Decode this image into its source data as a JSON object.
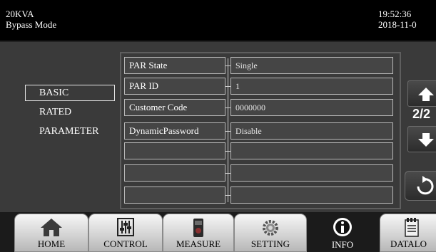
{
  "header": {
    "model": "20KVA",
    "mode": "Bypass Mode",
    "time": "19:52:36",
    "date": "2018-11-0"
  },
  "sidebar": {
    "items": [
      {
        "label": "BASIC",
        "selected": true
      },
      {
        "label": "RATED",
        "selected": false
      },
      {
        "label": "PARAMETER",
        "selected": false
      }
    ]
  },
  "table": {
    "rows": [
      {
        "label": "PAR State",
        "value": "Single"
      },
      {
        "label": "PAR ID",
        "value": "1"
      },
      {
        "label": "Customer Code",
        "value": "0000000"
      },
      {
        "label": "DynamicPassword",
        "value": "Disable"
      },
      {
        "label": "",
        "value": ""
      },
      {
        "label": "",
        "value": ""
      },
      {
        "label": "",
        "value": ""
      }
    ]
  },
  "pager": {
    "indicator": "2/2",
    "up_icon": "arrow-up-icon",
    "down_icon": "arrow-down-icon",
    "back_icon": "return-icon"
  },
  "toolbar": {
    "tabs": [
      {
        "label": "HOME",
        "icon": "home-icon",
        "active": false
      },
      {
        "label": "CONTROL",
        "icon": "sliders-icon",
        "active": false
      },
      {
        "label": "MEASURE",
        "icon": "meter-icon",
        "active": false
      },
      {
        "label": "SETTING",
        "icon": "gear-icon",
        "active": false
      },
      {
        "label": "INFO",
        "icon": "info-icon",
        "active": true
      },
      {
        "label": "DATALO",
        "icon": "datalog-icon",
        "active": false
      }
    ]
  },
  "colors": {
    "background": "#3a3a3a",
    "header": "#000000",
    "cell_fill": "#454545",
    "cell_border": "#b9b9b9"
  }
}
